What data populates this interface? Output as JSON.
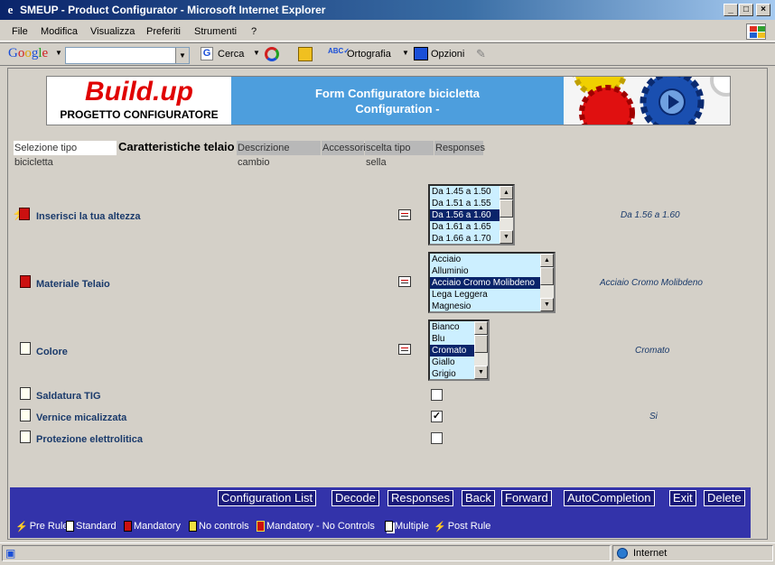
{
  "window": {
    "title": "SMEUP - Product Configurator - Microsoft Internet Explorer",
    "min": "_",
    "max": "□",
    "close": "×"
  },
  "menu": [
    "File",
    "Modifica",
    "Visualizza",
    "Preferiti",
    "Strumenti",
    "?"
  ],
  "toolbar": {
    "google": "Google",
    "search_value": "",
    "cerca": "Cerca",
    "ortografia": "Ortografia",
    "opzioni": "Opzioni"
  },
  "banner": {
    "logo": "Build.up",
    "logo_sub": "PROGETTO CONFIGURATORE",
    "title_line1": "Form Configuratore bicicletta",
    "title_line2": "Configuration   -"
  },
  "tabs": [
    "Selezione tipo bicicletta",
    "Caratteristiche telaio",
    "Descrizione cambio",
    "Accessori",
    "scelta tipo sella",
    "Responses"
  ],
  "rows": [
    {
      "label": "Inserisci la tua altezza",
      "icon": "post-rule-icon",
      "options": [
        "Da 1.45 a 1.50",
        "Da 1.51 a 1.55",
        "Da 1.56 a 1.60",
        "Da 1.61 a 1.65",
        "Da 1.66 a 1.70"
      ],
      "selected": 2,
      "value": "Da 1.56 a 1.60"
    },
    {
      "label": "Materiale Telaio",
      "icon": "mandatory-icon",
      "options": [
        "Acciaio",
        "Alluminio",
        "Acciaio Cromo Molibdeno",
        "Lega Leggera",
        "Magnesio"
      ],
      "selected": 2,
      "value": "Acciaio Cromo Molibdeno"
    },
    {
      "label": "Colore",
      "icon": "standard-icon",
      "options": [
        "Bianco",
        "Blu",
        "Cromato",
        "Giallo",
        "Grigio"
      ],
      "selected": 2,
      "value": "Cromato"
    },
    {
      "label": "Saldatura TIG",
      "icon": "standard-icon",
      "checked": false,
      "value": ""
    },
    {
      "label": "Vernice micalizzata",
      "icon": "standard-icon",
      "checked": true,
      "value": "Si"
    },
    {
      "label": "Protezione elettrolitica",
      "icon": "standard-icon",
      "checked": false,
      "value": ""
    }
  ],
  "buttons": [
    "Configuration List",
    "Decode",
    "Responses",
    "Back",
    "Forward",
    "AutoCompletion",
    "Exit",
    "Delete"
  ],
  "legend": [
    "Pre Rule",
    "Standard",
    "Mandatory",
    "No controls",
    "Mandatory - No Controls",
    "Multiple",
    "Post Rule"
  ],
  "status": {
    "zone": "Internet"
  },
  "colors": {
    "accent": "#3333aa",
    "banner": "#4d9edd",
    "selected": "#0a246a",
    "listbg": "#ccefff"
  }
}
